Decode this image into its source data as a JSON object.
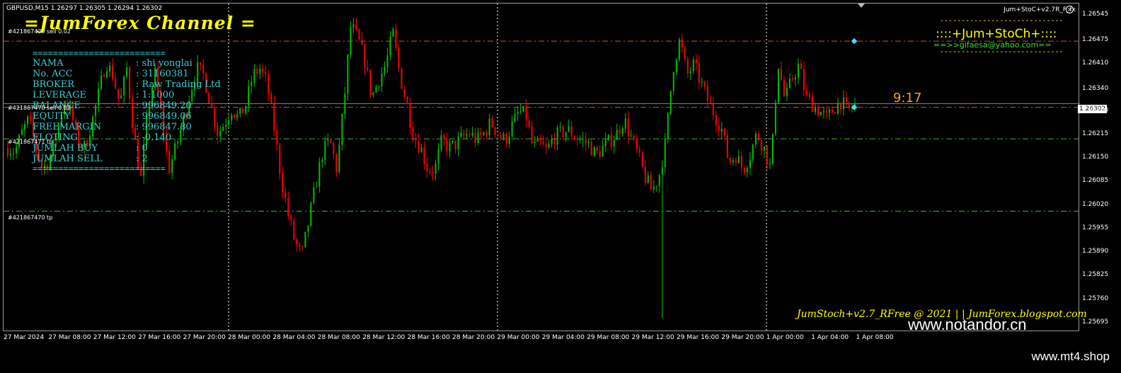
{
  "symbol": {
    "info": "GBPUSD,M15  1.26297 1.26305 1.26294 1.26302"
  },
  "channel_title": "=JumForex Channel =",
  "indicator": {
    "name": "Jum+StoC+v2.7R_F_fx",
    "close_icon": "close-circle-icon"
  },
  "brand": {
    "dashes_top": "-----------------------------",
    "title": "::::+Jum+StoCh+::::",
    "email": "==>>gifaesa@yahoo.com==",
    "dashes_bottom": "-----------------------------"
  },
  "timer": "9:17",
  "account": {
    "separator": "==========================",
    "rows": [
      {
        "label": "NAMA",
        "value": ": shi yonglai"
      },
      {
        "label": "No. ACC",
        "value": ": 31160381"
      },
      {
        "label": "BROKER",
        "value": ": Raw Trading Ltd"
      },
      {
        "label": "LEVERAGE",
        "value": ": 1:1000"
      },
      {
        "label": "BALANCE",
        "value": ": 996849.20"
      },
      {
        "label": "EQUITY",
        "value": ": 996849.06"
      },
      {
        "label": "FREEMARGIN",
        "value": ": 996847.80"
      },
      {
        "label": "FLOTING",
        "value": ": -0.140"
      },
      {
        "label": "JUMLAH BUY",
        "value": ": 0"
      },
      {
        "label": "JUMLAH SELL",
        "value": ": 2"
      }
    ]
  },
  "orders": [
    {
      "label": "#421867470 sell 0.02"
    },
    {
      "label": "#421867470 sell 0.02"
    },
    {
      "label": "#421867471 tp"
    },
    {
      "label": "#421867470 tp"
    }
  ],
  "current_price": "1.26302",
  "footer": {
    "credit": "JumStoch+v2.7_RFree @ 2021 | | JumForex.blogspot.com",
    "watermark_1": "www.notandor.cn",
    "watermark_2": "www.mt4.shop"
  },
  "colors": {
    "bull": "#00c000",
    "bear": "#ff0000",
    "grid": "#ffffff",
    "sell_line": "#c85a28",
    "tp_line": "#40b040",
    "price_line": "#808080"
  },
  "chart_data": {
    "type": "candlestick",
    "symbol": "GBPUSD",
    "timeframe": "M15",
    "y_ticks": [
      "1.26545",
      "1.26475",
      "1.26410",
      "1.26340",
      "1.26280",
      "1.26215",
      "1.26150",
      "1.26085",
      "1.26020",
      "1.25955",
      "1.25890",
      "1.25825",
      "1.25760",
      "1.25695"
    ],
    "ylim": [
      1.25675,
      1.26575
    ],
    "x_ticks": [
      "27 Mar 2024",
      "27 Mar 08:00",
      "27 Mar 12:00",
      "27 Mar 16:00",
      "27 Mar 20:00",
      "28 Mar 00:00",
      "28 Mar 04:00",
      "28 Mar 08:00",
      "28 Mar 12:00",
      "28 Mar 16:00",
      "28 Mar 20:00",
      "29 Mar 00:00",
      "29 Mar 04:00",
      "29 Mar 08:00",
      "29 Mar 12:00",
      "29 Mar 16:00",
      "29 Mar 20:00",
      "1 Apr 00:00",
      "1 Apr 04:00",
      "1 Apr 08:00"
    ],
    "levels": {
      "sell_entry_1": 1.26475,
      "sell_entry_2": 1.26292,
      "tp_1": 1.26205,
      "tp_2": 1.26005,
      "current": 1.26302
    },
    "path": [
      1.2618,
      1.2617,
      1.2622,
      1.2626,
      1.2618,
      1.2612,
      1.2615,
      1.2622,
      1.2631,
      1.2628,
      1.262,
      1.2618,
      1.2625,
      1.2633,
      1.2642,
      1.2638,
      1.263,
      1.264,
      1.2622,
      1.2609,
      1.2628,
      1.2639,
      1.2626,
      1.2612,
      1.2618,
      1.2625,
      1.2633,
      1.264,
      1.2638,
      1.263,
      1.2622,
      1.2625,
      1.2629,
      1.2626,
      1.263,
      1.2638,
      1.264,
      1.2636,
      1.2624,
      1.261,
      1.26,
      1.2592,
      1.2588,
      1.2598,
      1.2608,
      1.2617,
      1.262,
      1.2612,
      1.263,
      1.2652,
      1.2648,
      1.2642,
      1.2632,
      1.2637,
      1.2641,
      1.265,
      1.2638,
      1.263,
      1.2621,
      1.2618,
      1.2612,
      1.2612,
      1.262,
      1.2618,
      1.2619,
      1.2621,
      1.2622,
      1.262,
      1.2622,
      1.2625,
      1.2622,
      1.262,
      1.2624,
      1.2628,
      1.2627,
      1.2618,
      1.2619,
      1.2617,
      1.2621,
      1.2622,
      1.2623,
      1.2621,
      1.262,
      1.2619,
      1.2616,
      1.2618,
      1.262,
      1.2622,
      1.2626,
      1.2621,
      1.2616,
      1.261,
      1.2606,
      1.261,
      1.262,
      1.264,
      1.2648,
      1.2638,
      1.2641,
      1.2636,
      1.2631,
      1.2627,
      1.2623,
      1.2614,
      1.2616,
      1.2612,
      1.2616,
      1.2622,
      1.2618,
      1.2612,
      1.2642,
      1.2631,
      1.2637,
      1.2641,
      1.2632,
      1.263,
      1.2628,
      1.2626,
      1.2629,
      1.2631,
      1.2628,
      1.263
    ]
  }
}
